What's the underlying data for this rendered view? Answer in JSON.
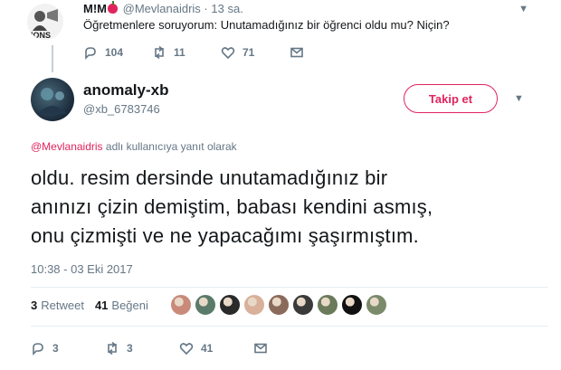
{
  "parent": {
    "name": "M!M",
    "handle": "@Mevlanaidris",
    "separator": "·",
    "time": "13 sa.",
    "text": "Öğretmenlere soruyorum: Unutamadığınız bir öğrenci oldu mu? Niçin?",
    "avatar_label": "IONS",
    "actions": {
      "reply": "104",
      "retweet": "11",
      "like": "71"
    }
  },
  "tweet": {
    "name": "anomaly-xb",
    "handle": "@xb_6783746",
    "follow_label": "Takip et",
    "reply_mention": "@Mevlanaidris",
    "reply_suffix": "adlı kullanıcıya yanıt olarak",
    "lines": [
      "oldu. resim dersinde unutamadığınız bir",
      "anınızı çizin demiştim, babası kendini asmış,",
      "onu çizmişti ve ne yapacağımı şaşırmıştım."
    ],
    "timestamp": "10:38 - 03 Eki 2017",
    "stats": {
      "retweet_count": "3",
      "retweet_label": "Retweet",
      "like_count": "41",
      "like_label": "Beğeni"
    },
    "liker_colors": [
      "#c98a7a",
      "#5a7a6a",
      "#2a2a2a",
      "#d9b09a",
      "#8a6a5a",
      "#3a3a3a",
      "#6a7a5a",
      "#111111",
      "#7a8a6a"
    ],
    "actions": {
      "reply": "3",
      "retweet": "3",
      "like": "41"
    }
  },
  "colors": {
    "accent": "#e0245e",
    "muted": "#657786",
    "text": "#14171a",
    "divider": "#e6ecf0"
  },
  "icons": [
    "reply-icon",
    "retweet-icon",
    "like-icon",
    "dm-icon",
    "caret-down-icon"
  ]
}
